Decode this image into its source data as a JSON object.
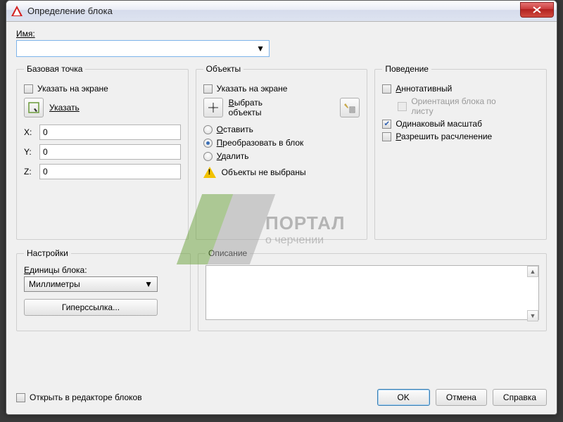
{
  "window": {
    "title": "Определение блока"
  },
  "name": {
    "label": "Имя:",
    "value": ""
  },
  "base_point": {
    "legend": "Базовая точка",
    "specify_on_screen": "Указать на экране",
    "pick_point": "Указать",
    "x_label": "X:",
    "x_value": "0",
    "y_label": "Y:",
    "y_value": "0",
    "z_label": "Z:",
    "z_value": "0"
  },
  "objects": {
    "legend": "Объекты",
    "specify_on_screen": "Указать на экране",
    "select_objects": "Выбрать объекты",
    "retain": "Оставить",
    "convert": "Преобразовать в блок",
    "delete": "Удалить",
    "warning": "Объекты не выбраны"
  },
  "behavior": {
    "legend": "Поведение",
    "annotative": "Аннотативный",
    "match_orientation": "Ориентация блока по листу",
    "scale_uniformly": "Одинаковый масштаб",
    "allow_exploding": "Разрешить расчленение"
  },
  "settings": {
    "legend": "Настройки",
    "block_unit_label": "Единицы блока:",
    "block_unit_value": "Миллиметры",
    "hyperlink": "Гиперссылка..."
  },
  "description": {
    "legend": "Описание",
    "value": ""
  },
  "footer": {
    "open_in_editor": "Открыть в редакторе блоков",
    "ok": "OK",
    "cancel": "Отмена",
    "help": "Справка"
  },
  "watermark": {
    "line1": "ПОРТАЛ",
    "line2": "о черчении"
  }
}
